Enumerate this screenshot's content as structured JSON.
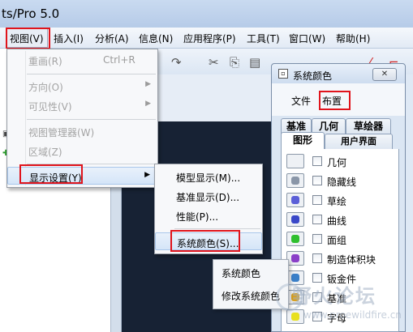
{
  "window": {
    "title": "ts/Pro 5.0"
  },
  "menubar": {
    "items": [
      {
        "label": "视图(V)"
      },
      {
        "label": "插入(I)"
      },
      {
        "label": "分析(A)"
      },
      {
        "label": "信息(N)"
      },
      {
        "label": "应用程序(P)"
      },
      {
        "label": "工具(T)"
      },
      {
        "label": "窗口(W)"
      },
      {
        "label": "帮助(H)"
      }
    ]
  },
  "view_menu": {
    "items": [
      {
        "label": "重画(R)",
        "shortcut": "Ctrl+R"
      },
      {
        "label": "方向(O)"
      },
      {
        "label": "可见性(V)"
      },
      {
        "label": "视图管理器(W)"
      },
      {
        "label": "区域(Z)"
      },
      {
        "label": "显示设置(Y)"
      }
    ]
  },
  "display_submenu": {
    "items": [
      {
        "label": "模型显示(M)..."
      },
      {
        "label": "基准显示(D)..."
      },
      {
        "label": "性能(P)..."
      },
      {
        "label": "系统颜色(S)..."
      }
    ]
  },
  "system_colors_dialog": {
    "title": "系统颜色",
    "close_icon": "close-icon",
    "menu": {
      "file": "文件",
      "layout": "布置"
    },
    "tabs_row1": [
      "基准",
      "几何",
      "草绘器"
    ],
    "tabs_row2": [
      "图形",
      "用户界面"
    ],
    "color_items": [
      {
        "label": "几何",
        "color": "#f4f6f9"
      },
      {
        "label": "隐藏线",
        "color": "#8a96a8"
      },
      {
        "label": "草绘",
        "color": "#5b5fd8"
      },
      {
        "label": "曲线",
        "color": "#3a48c8"
      },
      {
        "label": "面组",
        "color": "#2fbf2f"
      },
      {
        "label": "制造体积块",
        "color": "#8a3fc8"
      },
      {
        "label": "钣金件",
        "color": "#3a7fc8"
      },
      {
        "label": "基准",
        "color": "#d8a020"
      },
      {
        "label": "字母",
        "color": "#e8e020"
      }
    ]
  },
  "popup_menu": {
    "items": [
      {
        "label": "系统颜色"
      },
      {
        "label": "修改系统颜色"
      }
    ]
  },
  "watermark": {
    "text": "野火论坛",
    "url": "www.proewildfire.cn"
  },
  "colors": {
    "highlight_box": "#e0141c",
    "graphics_bg": "#172234"
  }
}
